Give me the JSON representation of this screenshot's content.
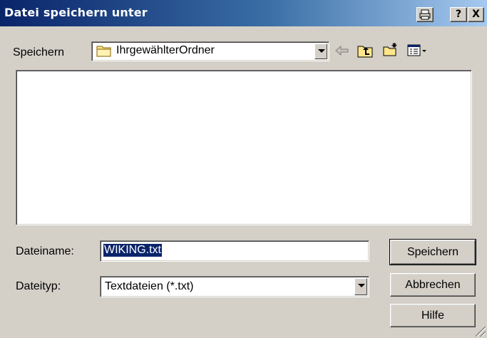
{
  "window": {
    "title": "Datei speichern unter",
    "help_glyph": "?",
    "close_glyph": "X"
  },
  "save_in": {
    "label": "Speichern",
    "location": "IhrgewählterOrdner"
  },
  "filename": {
    "label": "Dateiname:",
    "value": "WIKING.txt"
  },
  "filetype": {
    "label": "Dateityp:",
    "value": "Textdateien (*.txt)"
  },
  "buttons": {
    "save": "Speichern",
    "cancel": "Abbrechen",
    "help": "Hilfe"
  },
  "icons": {
    "folder": "folder-icon",
    "back": "back-arrow-icon",
    "up": "up-one-level-icon",
    "new_folder": "new-folder-icon",
    "view": "view-menu-icon",
    "print": "print-icon"
  },
  "colors": {
    "title_start": "#0a246a",
    "title_end": "#a6caf0",
    "face": "#d4d0c8",
    "selection": "#0a246a"
  }
}
